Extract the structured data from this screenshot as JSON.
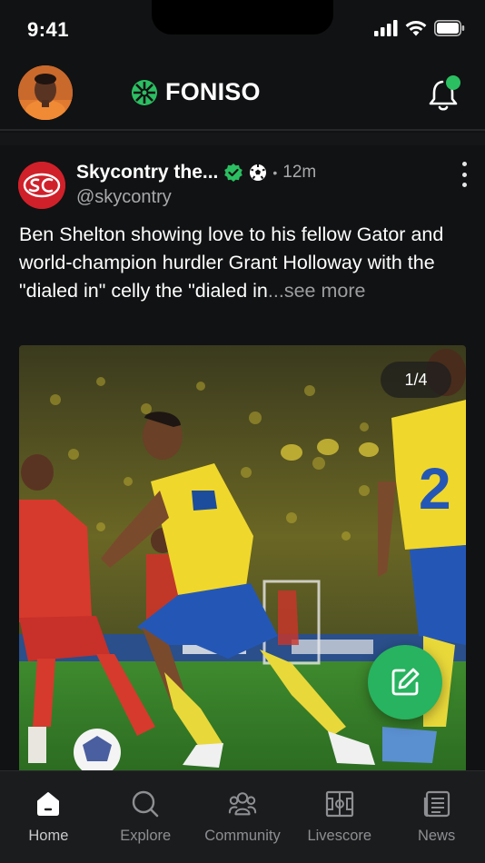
{
  "status_bar": {
    "time": "9:41"
  },
  "header": {
    "brand": "FONISO",
    "brand_color": "#2bbf62",
    "notification_dot_color": "#2bbf62"
  },
  "post": {
    "author_name": "Skycontry the...",
    "verified_icon": "verified-check-icon",
    "badge_icon": "soccer-ball-icon",
    "time": "12m",
    "handle": "@skycontry",
    "text": "Ben Shelton showing love to his fellow Gator and world-champion hurdler Grant Holloway with the \"dialed in\" celly the \"dialed in",
    "see_more": "...see more",
    "media_counter": "1/4",
    "avatar_initials": "SC"
  },
  "fab": {
    "icon": "compose-icon",
    "color": "#27b35f"
  },
  "bottom_nav": [
    {
      "label": "Home",
      "icon": "home-icon",
      "active": true
    },
    {
      "label": "Explore",
      "icon": "search-icon",
      "active": false
    },
    {
      "label": "Community",
      "icon": "community-icon",
      "active": false
    },
    {
      "label": "Livescore",
      "icon": "pitch-icon",
      "active": false
    },
    {
      "label": "News",
      "icon": "news-icon",
      "active": false
    }
  ]
}
